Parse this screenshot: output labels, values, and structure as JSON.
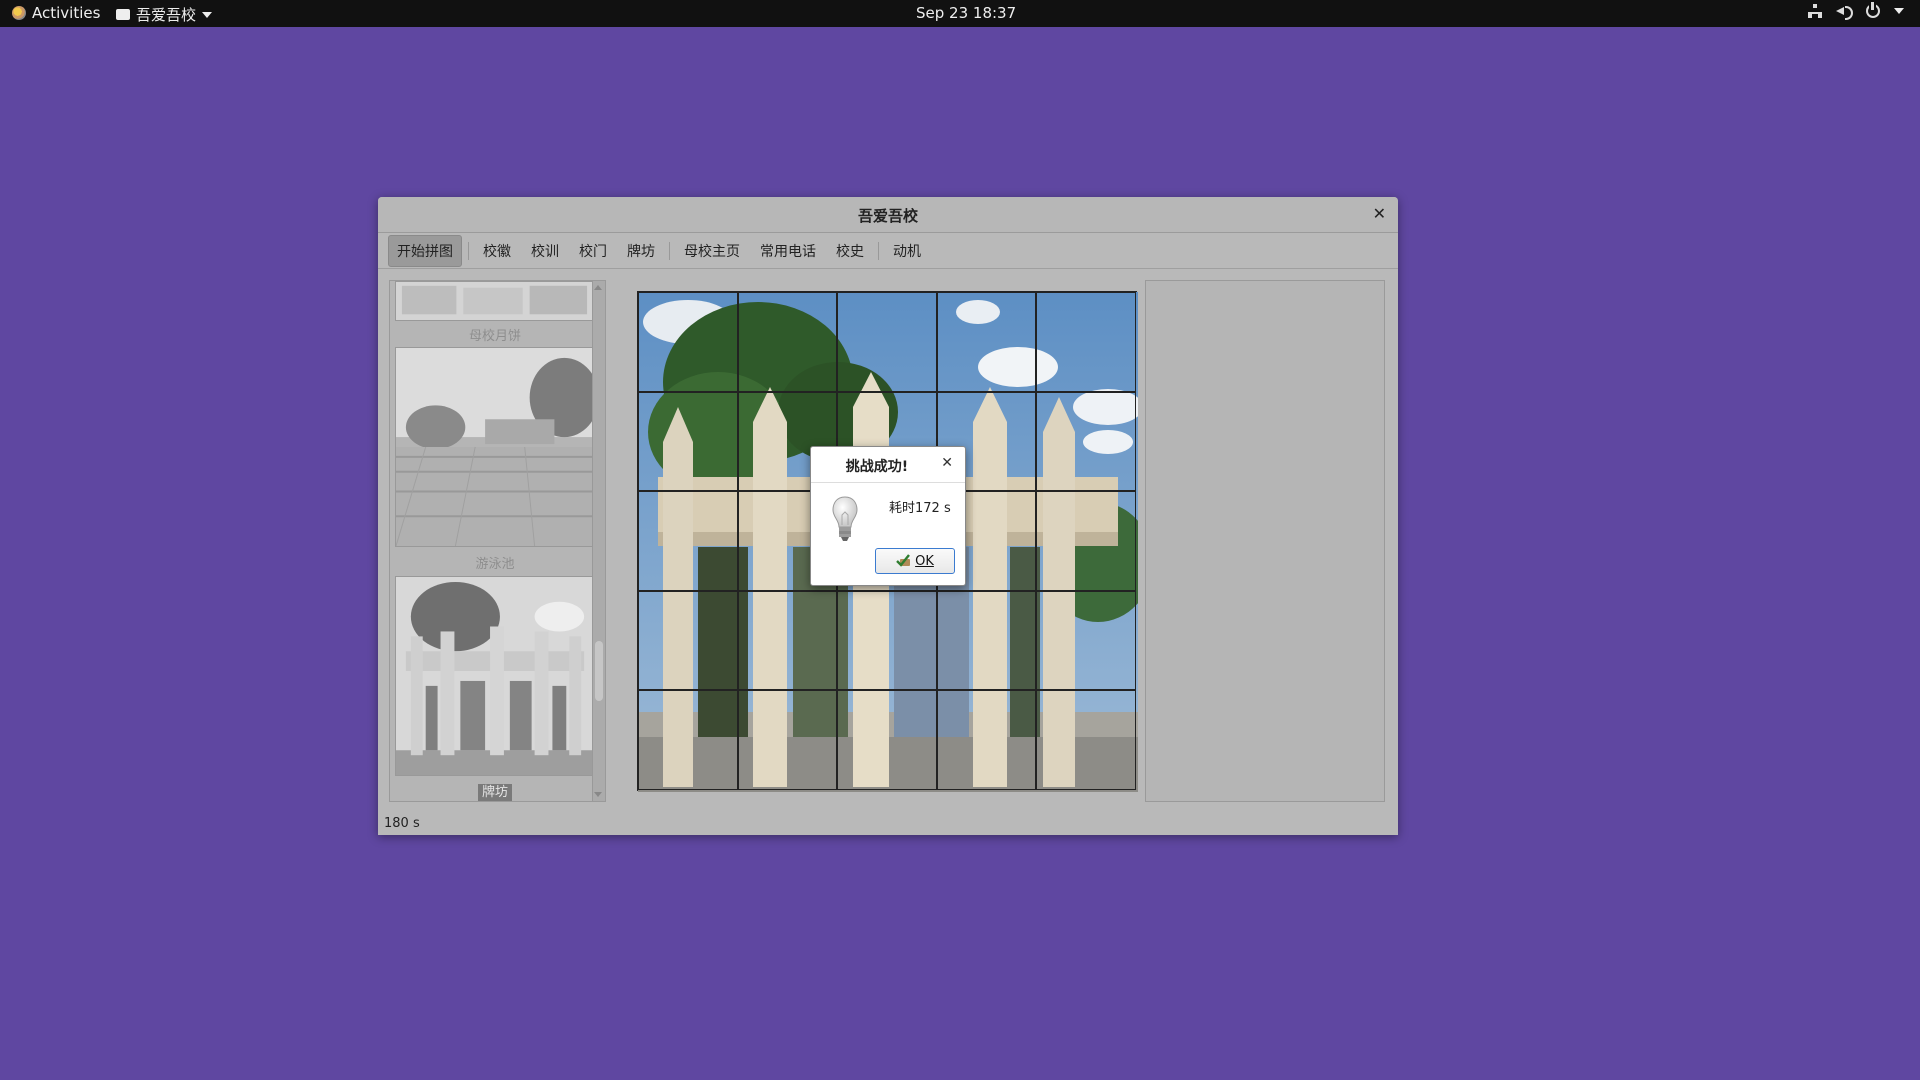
{
  "topbar": {
    "activities": "Activities",
    "app_name": "吾爱吾校",
    "clock": "Sep 23  18:37"
  },
  "window": {
    "title": "吾爱吾校",
    "toolbar": [
      "开始拼图",
      "校徽",
      "校训",
      "校门",
      "牌坊",
      "母校主页",
      "常用电话",
      "校史",
      "动机"
    ],
    "thumbnails": [
      {
        "label": "母校月饼"
      },
      {
        "label": "游泳池"
      },
      {
        "label": "牌坊",
        "selected": true
      }
    ],
    "status": "180 s"
  },
  "dialog": {
    "title": "挑战成功!",
    "message": "耗时172 s",
    "ok": "OK"
  },
  "colors": {
    "desktop": "#5f47a1",
    "topbar": "#111111",
    "window_dimmed": "#b9b9b9"
  }
}
